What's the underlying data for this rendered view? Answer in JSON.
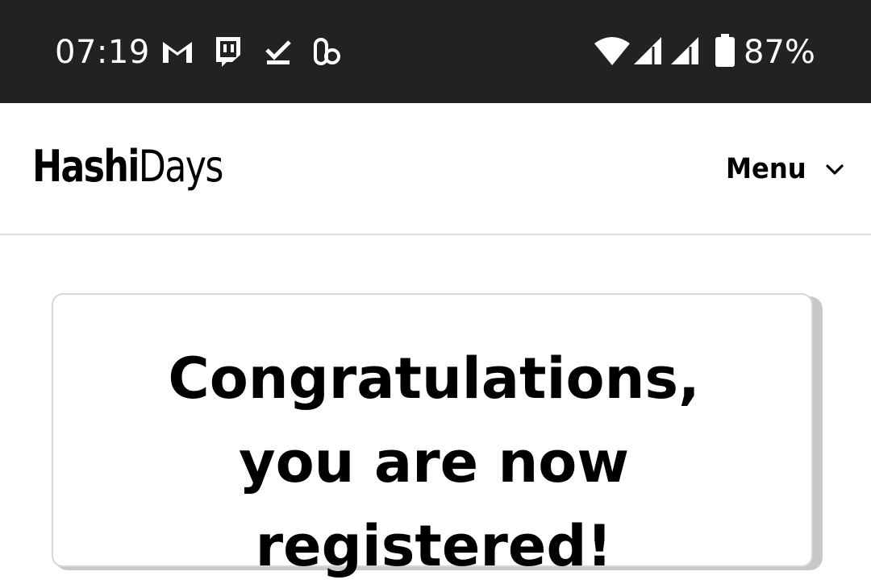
{
  "status_bar": {
    "time": "07:19",
    "notification_icons": [
      "gmail-icon",
      "twitch-icon",
      "download-done-icon",
      "app-icon"
    ],
    "system_icons": [
      "wifi-icon",
      "signal-icon",
      "signal-icon",
      "battery-icon"
    ],
    "battery_percent": "87%",
    "background": "#222222"
  },
  "header": {
    "logo_bold": "Hashi",
    "logo_light": "Days",
    "menu_label": "Menu",
    "menu_icon": "chevron-down-icon"
  },
  "card": {
    "title": "Congratulations, you are now registered!"
  }
}
